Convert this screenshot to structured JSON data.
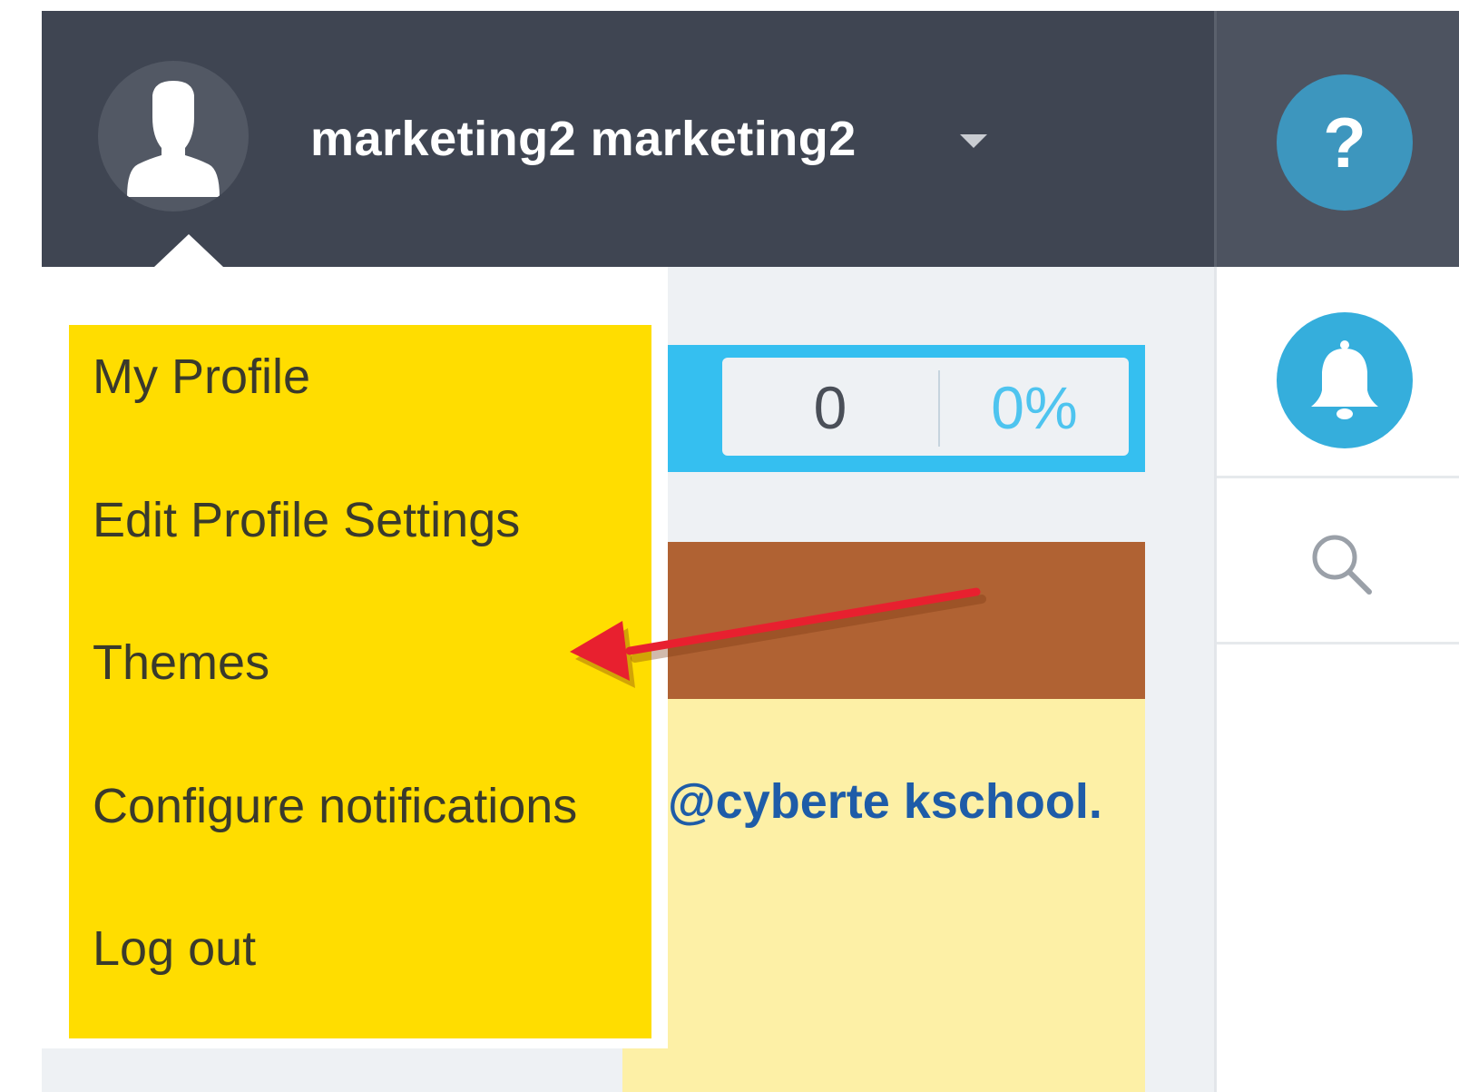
{
  "header": {
    "user_name": "marketing2 marketing2",
    "avatar_icon": "user-silhouette-icon",
    "caret_icon": "caret-down-icon"
  },
  "toolbar": {
    "help_label": "?",
    "help_color": "#3d96be",
    "notifications_icon": "bell-icon",
    "notifications_color": "#35aedc",
    "search_icon": "search-icon"
  },
  "stats": {
    "count": "0",
    "percent": "0%"
  },
  "content": {
    "email_fragment": "@cyberte kschool."
  },
  "profile_menu": {
    "items": [
      {
        "label": "My Profile"
      },
      {
        "label": "Edit Profile Settings"
      },
      {
        "label": "Themes"
      },
      {
        "label": "Configure notifications"
      },
      {
        "label": "Log out"
      }
    ],
    "highlight_color": "#ffdd00"
  },
  "annotation": {
    "type": "arrow",
    "points_to": "Themes",
    "color": "#e8202f"
  },
  "colors": {
    "header_bg": "#3f4552",
    "stats_bar": "#35bff0",
    "banner": "#b06233",
    "cream": "#fdf0a6",
    "email_text": "#1e5ca8"
  }
}
